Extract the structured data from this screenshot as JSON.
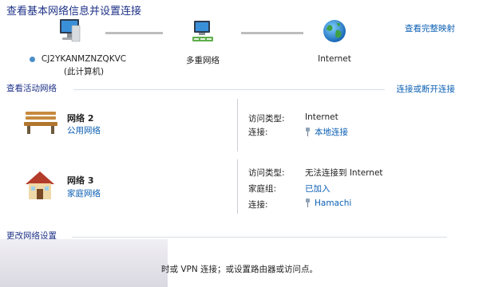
{
  "header": {
    "title": "查看基本网络信息并设置连接",
    "full_map_link": "查看完整映射"
  },
  "map": {
    "computer_name": "CJ2YKANMZNZQKVC",
    "computer_sub": "(此计算机)",
    "middle_label": "多重网络",
    "internet_label": "Internet"
  },
  "active": {
    "heading": "查看活动网络",
    "connect_link": "连接或断开连接",
    "networks": [
      {
        "name": "网络 2",
        "type": "公用网络",
        "rows": [
          {
            "label": "访问类型:",
            "value": "Internet",
            "is_link": false
          },
          {
            "label": "连接:",
            "value": "本地连接",
            "is_link": true,
            "icon": "cable-icon"
          }
        ]
      },
      {
        "name": "网络 3",
        "type": "家庭网络",
        "rows": [
          {
            "label": "访问类型:",
            "value": "无法连接到 Internet",
            "is_link": false
          },
          {
            "label": "家庭组:",
            "value": "已加入",
            "is_link": true
          },
          {
            "label": "连接:",
            "value": "Hamachi",
            "is_link": true,
            "icon": "cable-icon"
          }
        ]
      }
    ]
  },
  "change": {
    "heading": "更改网络设置",
    "text": "时或 VPN 连接；或设置路由器或访问点。"
  }
}
